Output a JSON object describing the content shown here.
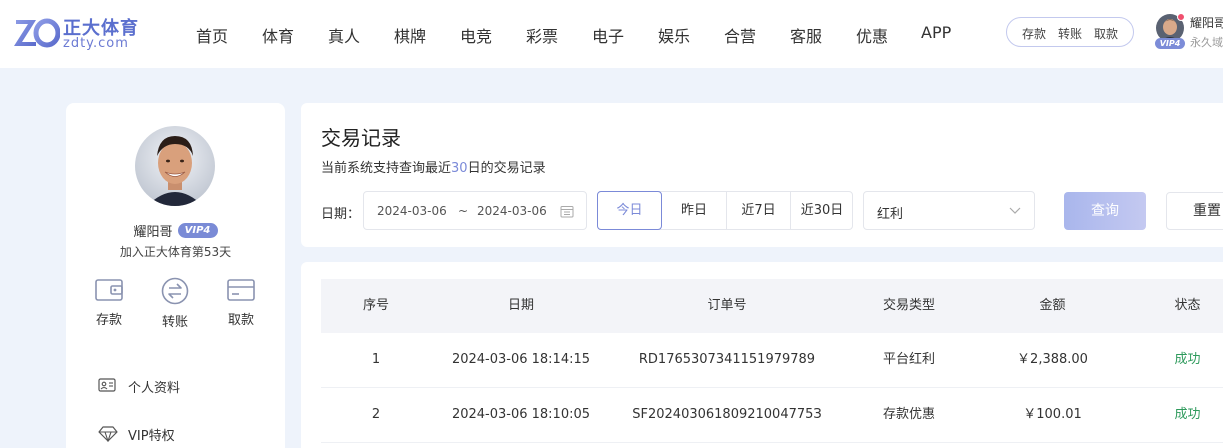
{
  "header": {
    "logo": {
      "mark": "ZD",
      "title": "正大体育",
      "subtitle": "zdty.com"
    },
    "nav": [
      "首页",
      "体育",
      "真人",
      "棋牌",
      "电竞",
      "彩票",
      "电子",
      "娱乐",
      "合营",
      "客服",
      "优惠",
      "APP"
    ],
    "quick_actions": {
      "deposit": "存款",
      "transfer": "转账",
      "withdraw": "取款"
    },
    "user": {
      "name": "耀阳哥",
      "vip": "VIP4",
      "sub": "永久域"
    }
  },
  "sidebar": {
    "user_name": "耀阳哥",
    "vip_label": "VIP4",
    "join_text": "加入正大体育第53天",
    "actions": [
      {
        "label": "存款",
        "icon": "wallet-icon"
      },
      {
        "label": "转账",
        "icon": "transfer-icon"
      },
      {
        "label": "取款",
        "icon": "card-icon"
      }
    ],
    "menu": [
      {
        "label": "个人资料",
        "icon": "id-card-icon"
      },
      {
        "label": "VIP特权",
        "icon": "diamond-icon"
      }
    ]
  },
  "filter": {
    "title": "交易记录",
    "note_prefix": "当前系统支持查询最近",
    "note_days": "30",
    "note_suffix": "日的交易记录",
    "date_label": "日期：",
    "start_date": "2024-03-06",
    "date_separator": "~",
    "end_date": "2024-03-06",
    "quick_ranges": [
      "今日",
      "昨日",
      "近7日",
      "近30日"
    ],
    "active_range": "今日",
    "type_selected": "红利",
    "query_label": "查询",
    "reset_label": "重置"
  },
  "table": {
    "headers": [
      "序号",
      "日期",
      "订单号",
      "交易类型",
      "金额",
      "状态"
    ],
    "rows": [
      [
        "1",
        "2024-03-06 18:14:15",
        "RD1765307341151979789",
        "平台红利",
        "￥2,388.00",
        "成功"
      ],
      [
        "2",
        "2024-03-06 18:10:05",
        "SF20240306180921004775З",
        "存款优惠",
        "￥100.01",
        "成功"
      ]
    ]
  },
  "colors": {
    "accent": "#7b8ad8",
    "success": "#2e9a5c",
    "page_bg": "#eef3fb"
  }
}
